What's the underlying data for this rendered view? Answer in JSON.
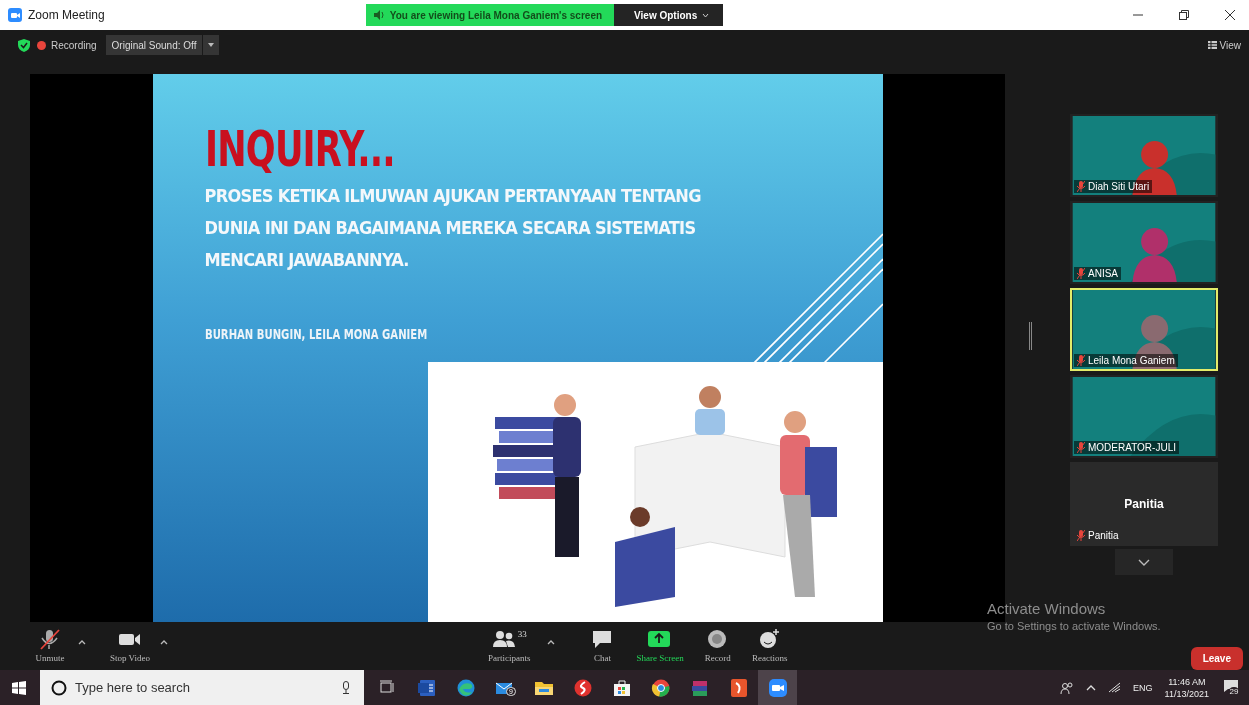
{
  "window": {
    "title": "Zoom Meeting"
  },
  "share_banner": {
    "text": "You are viewing Leila Mona Ganiem's screen",
    "options": "View Options"
  },
  "meeting_bar": {
    "recording": "Recording",
    "sound": "Original Sound: Off",
    "view": "View"
  },
  "slide": {
    "title": "INQUIRY...",
    "lines": [
      "PROSES KETIKA ILMUWAN AJUKAN PERTANYAAN TENTANG",
      "DUNIA INI DAN BAGAIMANA MEREKA SECARA SISTEMATIS",
      "MENCARI JAWABANNYA."
    ],
    "authors": "BURHAN BUNGIN, LEILA MONA GANIEM"
  },
  "participants": [
    {
      "name": "Diah Siti Utari",
      "kind": "video",
      "muted": true,
      "selected": false
    },
    {
      "name": "ANISA",
      "kind": "video",
      "muted": true,
      "selected": false
    },
    {
      "name": "Leila Mona Ganiem",
      "kind": "video",
      "muted": true,
      "selected": true
    },
    {
      "name": "MODERATOR-JULI",
      "kind": "video",
      "muted": true,
      "selected": false
    },
    {
      "name": "Panitia",
      "kind": "avatar",
      "display": "Panitia",
      "muted": true,
      "selected": false
    }
  ],
  "controls": [
    {
      "label": "Unmute",
      "kind": "mic",
      "caret": true
    },
    {
      "label": "Stop Video",
      "kind": "video",
      "caret": true
    },
    {
      "label": "Participants",
      "kind": "participants",
      "count": "33",
      "caret": true
    },
    {
      "label": "Chat",
      "kind": "chat",
      "caret": false
    },
    {
      "label": "Share Screen",
      "kind": "share",
      "caret": false
    },
    {
      "label": "Record",
      "kind": "record",
      "caret": false
    },
    {
      "label": "Reactions",
      "kind": "reactions",
      "caret": false
    }
  ],
  "leave": "Leave",
  "activation": {
    "title": "Activate Windows",
    "text": "Go to Settings to activate Windows."
  },
  "taskbar": {
    "search": {
      "placeholder": "Type here to search"
    },
    "apps": [
      {
        "kind": "taskview",
        "active": false
      },
      {
        "kind": "document",
        "active": false
      },
      {
        "kind": "browser",
        "active": false
      },
      {
        "kind": "mail",
        "badge": "9",
        "active": false
      },
      {
        "kind": "folder",
        "active": false
      },
      {
        "kind": "redapp",
        "active": false
      },
      {
        "kind": "store",
        "active": false
      },
      {
        "kind": "chrome",
        "active": false
      },
      {
        "kind": "books",
        "active": false
      },
      {
        "kind": "redsquare",
        "active": false
      },
      {
        "kind": "camera",
        "active": true
      }
    ],
    "language": "ENG",
    "time": "11:46 AM",
    "date": "11/13/2021",
    "notifications": "29"
  }
}
